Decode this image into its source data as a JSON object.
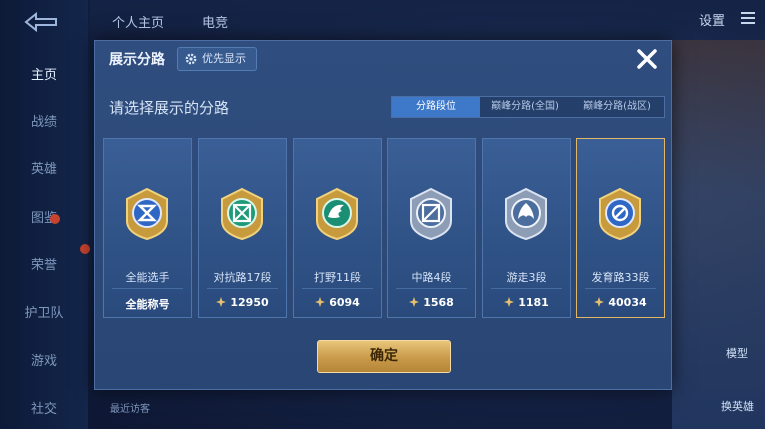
{
  "nav": {
    "items": [
      {
        "label": "主页",
        "active": true
      },
      {
        "label": "战绩"
      },
      {
        "label": "英雄"
      },
      {
        "label": "图鉴"
      },
      {
        "label": "荣誉"
      },
      {
        "label": "护卫队"
      },
      {
        "label": "游戏"
      },
      {
        "label": "社交"
      }
    ]
  },
  "topbar": {
    "tabs": [
      "个人主页",
      "电竞"
    ],
    "settings_label": "设置"
  },
  "background": {
    "model_label": "模型",
    "change_hero_label": "换英雄",
    "visitor_label": "最近访客"
  },
  "modal": {
    "title": "展示分路",
    "priority_label": "优先显示",
    "subtitle": "请选择展示的分路",
    "tabs": [
      {
        "label": "分路段位",
        "active": true
      },
      {
        "label": "巅峰分路(全国)"
      },
      {
        "label": "巅峰分路(战区)"
      }
    ],
    "cards": [
      {
        "name": "全能选手",
        "value": "全能称号",
        "icon": "allround-emblem-icon"
      },
      {
        "name": "对抗路17段",
        "value": "12950",
        "icon": "clash-lane-emblem-icon"
      },
      {
        "name": "打野11段",
        "value": "6094",
        "icon": "jungle-emblem-icon"
      },
      {
        "name": "中路4段",
        "value": "1568",
        "icon": "mid-lane-emblem-icon"
      },
      {
        "name": "游走3段",
        "value": "1181",
        "icon": "roam-emblem-icon"
      },
      {
        "name": "发育路33段",
        "value": "40034",
        "icon": "farm-lane-emblem-icon",
        "selected": true
      }
    ],
    "confirm_label": "确定"
  },
  "colors": {
    "accent_gold": "#e2b765",
    "tab_active": "#3e78c8",
    "modal_bg": "#2f4d7e"
  }
}
